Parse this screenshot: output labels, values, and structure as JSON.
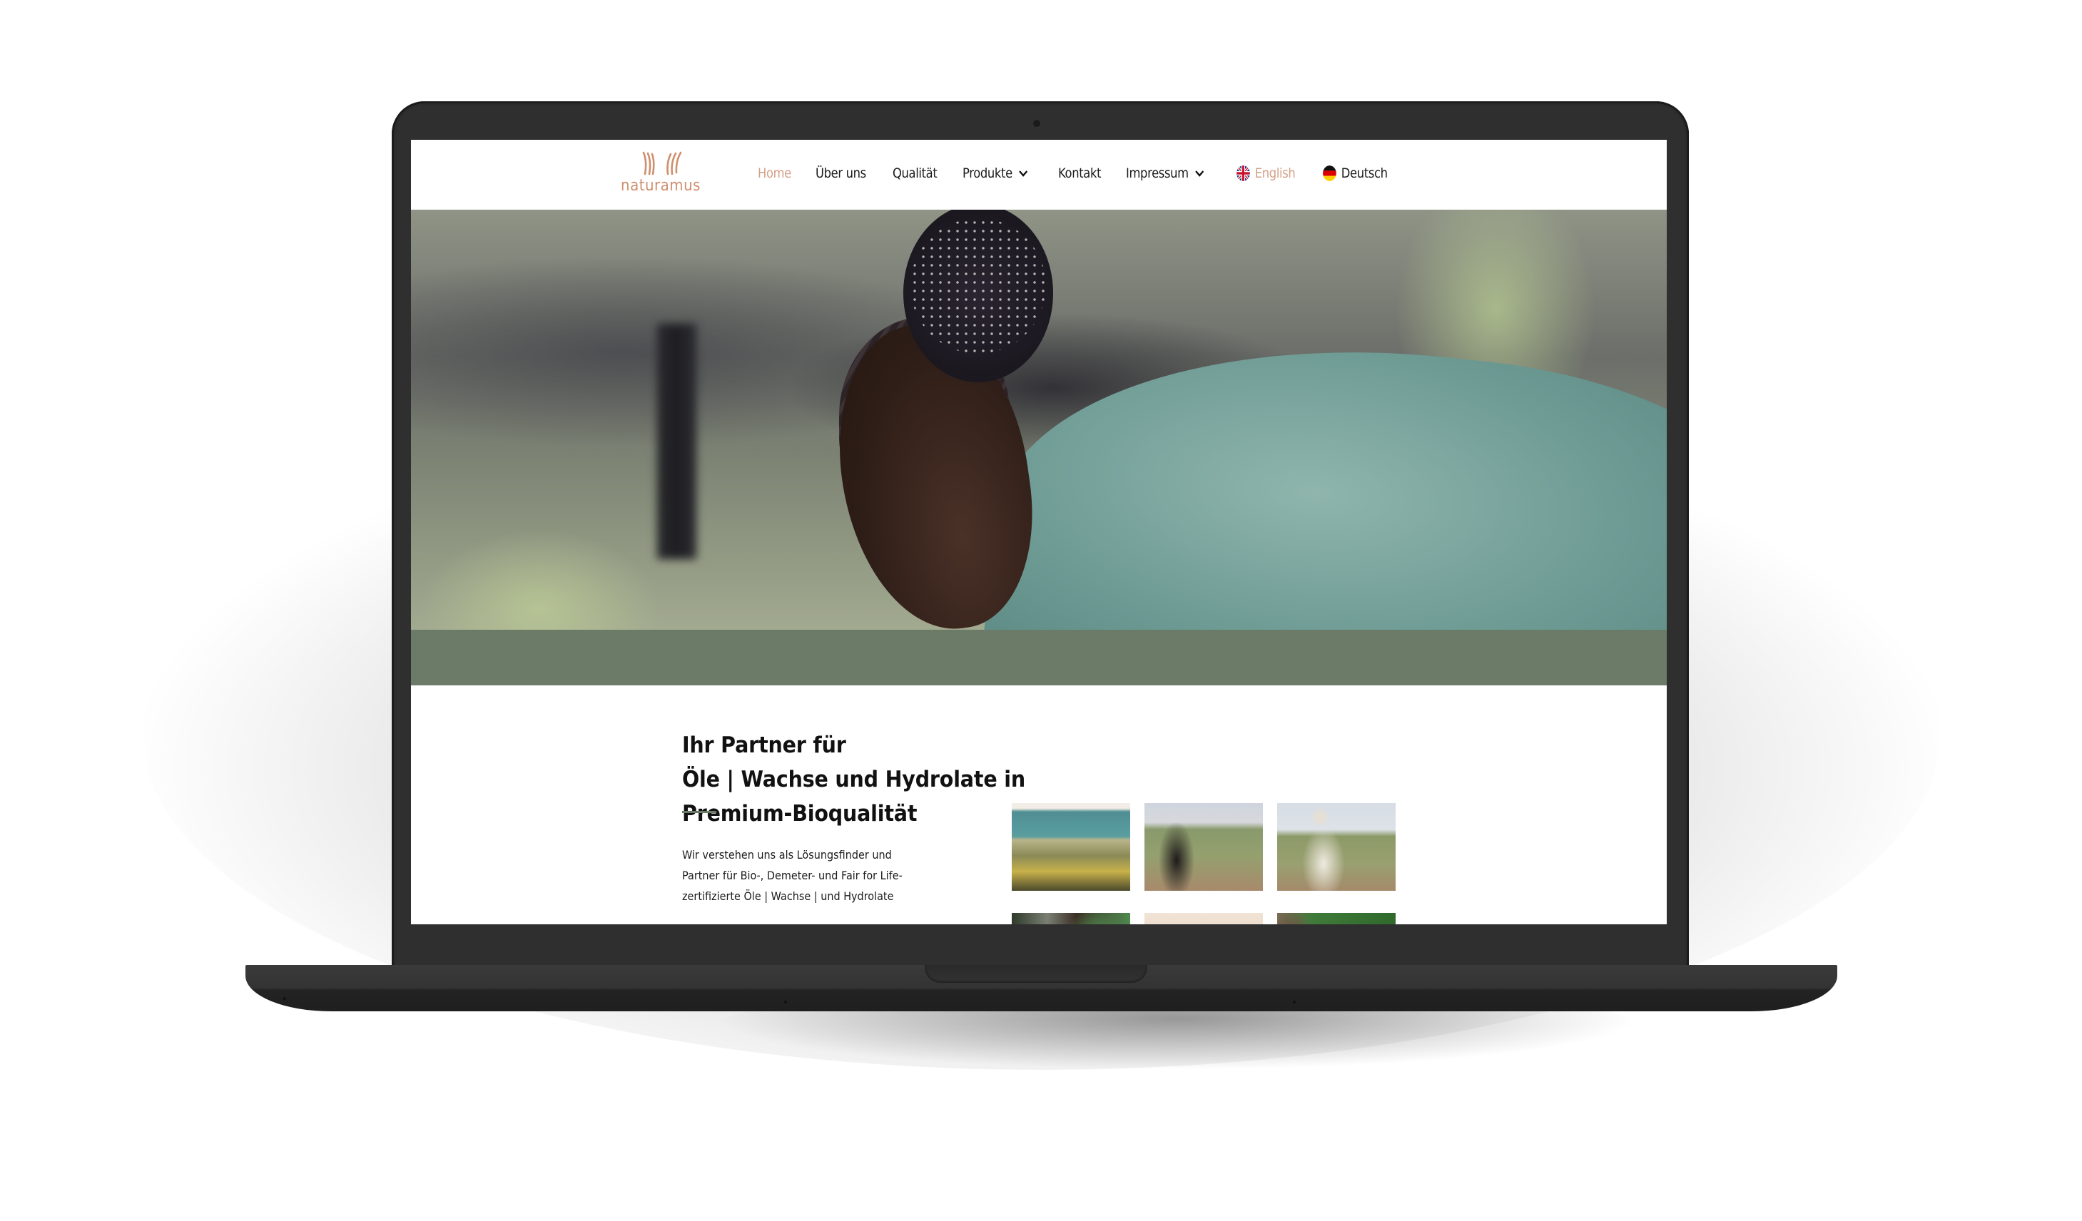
{
  "device": "laptop-mockup",
  "site": {
    "brand": {
      "name": "naturamus",
      "icon": "wheat-stalks-logo-icon",
      "color": "#cf8f6d"
    },
    "nav": {
      "items": [
        {
          "label": "Home",
          "active": true
        },
        {
          "label": "Über uns"
        },
        {
          "label": "Qualität"
        },
        {
          "label": "Produkte",
          "has_dropdown": true,
          "icon": "chevron-down-icon"
        },
        {
          "label": "Kontakt"
        },
        {
          "label": "Impressum",
          "has_dropdown": true,
          "icon": "chevron-down-icon"
        }
      ],
      "languages": [
        {
          "label": "English",
          "icon": "uk-flag-icon",
          "active": true
        },
        {
          "label": "Deutsch",
          "icon": "german-flag-icon"
        }
      ]
    },
    "hero": {
      "image": "woman-in-teal-shirt-working-in-field-photo"
    },
    "band_color": "#6b7b68",
    "accent_color": "#d4a088",
    "intro": {
      "heading_lines": [
        "Ihr Partner für",
        "Öle | Wachse und Hydrolate in",
        "Premium-Bioqualität"
      ],
      "paragraph_lines": [
        "Wir verstehen uns als Lösungsfinder und",
        "Partner für Bio-, Demeter- und Fair for Life-",
        "zertifizierte Öle | Wachse | und Hydrolate"
      ]
    },
    "gallery": [
      {
        "image": "hillside-with-sheep-photo"
      },
      {
        "image": "woman-harvesting-in-field-photo"
      },
      {
        "image": "farmer-with-turban-in-field-photo"
      },
      {
        "image": "smiling-worker-with-green-hood-photo"
      },
      {
        "image": "sandy-landscape-photo"
      },
      {
        "image": "person-among-green-plants-photo"
      }
    ]
  }
}
